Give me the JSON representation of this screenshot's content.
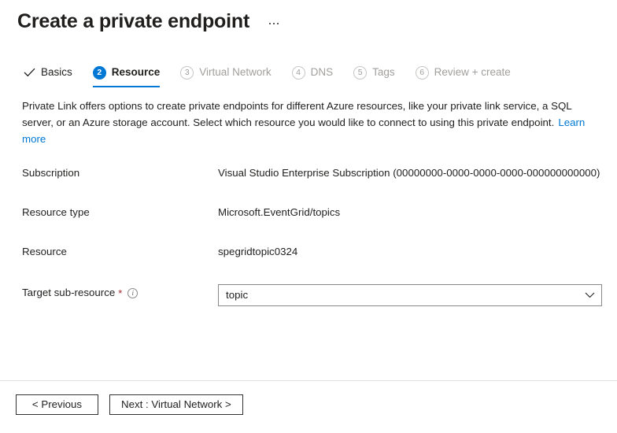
{
  "header": {
    "title": "Create a private endpoint",
    "more_menu": "…"
  },
  "tabs": [
    {
      "label": "Basics",
      "state": "done",
      "marker": "check"
    },
    {
      "label": "Resource",
      "state": "active",
      "marker": "2"
    },
    {
      "label": "Virtual Network",
      "state": "inactive",
      "marker": "3"
    },
    {
      "label": "DNS",
      "state": "inactive",
      "marker": "4"
    },
    {
      "label": "Tags",
      "state": "inactive",
      "marker": "5"
    },
    {
      "label": "Review + create",
      "state": "inactive",
      "marker": "6"
    }
  ],
  "description": {
    "text": "Private Link offers options to create private endpoints for different Azure resources, like your private link service, a SQL server, or an Azure storage account. Select which resource you would like to connect to using this private endpoint.",
    "link_label": "Learn more"
  },
  "fields": {
    "subscription": {
      "label": "Subscription",
      "value": "Visual Studio Enterprise Subscription (00000000-0000-0000-0000-000000000000)"
    },
    "resource_type": {
      "label": "Resource type",
      "value": "Microsoft.EventGrid/topics"
    },
    "resource": {
      "label": "Resource",
      "value": "spegridtopic0324"
    },
    "target_sub_resource": {
      "label": "Target sub-resource",
      "required_marker": "*",
      "info_glyph": "i",
      "value": "topic",
      "options": [
        "topic"
      ]
    }
  },
  "footer": {
    "previous_label": "< Previous",
    "next_label": "Next : Virtual Network >"
  },
  "colors": {
    "accent": "#0078d4",
    "required": "#a4262c",
    "text": "#201f1e",
    "muted": "#a19f9d",
    "border": "#8a8886"
  }
}
